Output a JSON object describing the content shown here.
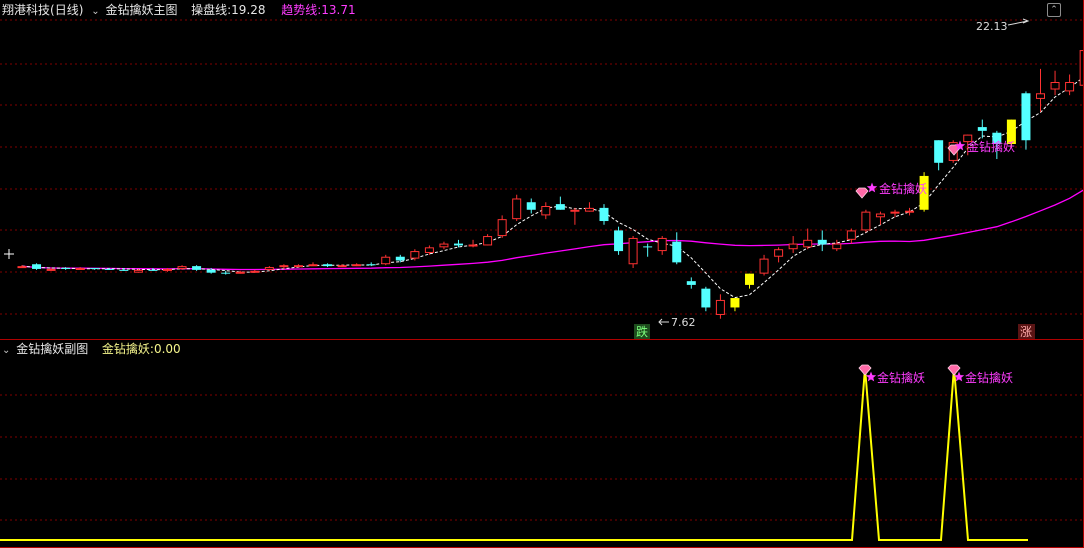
{
  "main_panel": {
    "title": "金钻擒妖主图",
    "stock": "翔港科技",
    "period": "(日线)",
    "ind1_label": "操盘线",
    "ind1_value": "19.28",
    "ind2_label": "趋势线",
    "ind2_value": "13.71",
    "high_label": "22.13",
    "low_label": "7.62",
    "signal_label": "金钻擒妖",
    "marker_down": "跌",
    "marker_up": "涨"
  },
  "sub_panel": {
    "title": "金钻擒妖副图",
    "ind_label": "金钻擒妖",
    "ind_value": "0.00",
    "signal_label": "金钻擒妖"
  },
  "colors": {
    "up": "#ff3232",
    "down": "#54ffff",
    "signal": "#ffff00",
    "trend": "#ff00ff",
    "grid": "#800000",
    "border": "#b00000",
    "sub_line": "#ffff00"
  },
  "chart_data": {
    "type": "candlestick",
    "y_range": [
      7.0,
      23.5
    ],
    "candles": [
      [
        10.4,
        10.45,
        10.35,
        10.4,
        "u"
      ],
      [
        10.5,
        10.55,
        10.2,
        10.25,
        "d"
      ],
      [
        10.25,
        10.3,
        10.2,
        10.25,
        "u"
      ],
      [
        10.3,
        10.35,
        10.2,
        10.25,
        "d"
      ],
      [
        10.2,
        10.35,
        10.2,
        10.3,
        "u"
      ],
      [
        10.3,
        10.3,
        10.2,
        10.25,
        "d"
      ],
      [
        10.25,
        10.3,
        10.2,
        10.25,
        "d"
      ],
      [
        10.2,
        10.3,
        10.15,
        10.2,
        "d"
      ],
      [
        10.05,
        10.25,
        10.05,
        10.2,
        "u"
      ],
      [
        10.2,
        10.3,
        10.15,
        10.2,
        "d"
      ],
      [
        10.2,
        10.3,
        10.1,
        10.25,
        "u"
      ],
      [
        10.25,
        10.45,
        10.2,
        10.4,
        "u"
      ],
      [
        10.4,
        10.45,
        10.15,
        10.2,
        "d"
      ],
      [
        10.2,
        10.3,
        10.0,
        10.05,
        "d"
      ],
      [
        10.05,
        10.15,
        9.95,
        10.0,
        "d"
      ],
      [
        10.05,
        10.15,
        10.0,
        10.1,
        "u"
      ],
      [
        10.1,
        10.2,
        10.05,
        10.15,
        "u"
      ],
      [
        10.2,
        10.4,
        10.15,
        10.35,
        "u"
      ],
      [
        10.35,
        10.5,
        10.25,
        10.45,
        "u"
      ],
      [
        10.45,
        10.5,
        10.35,
        10.45,
        "u"
      ],
      [
        10.45,
        10.6,
        10.4,
        10.5,
        "u"
      ],
      [
        10.5,
        10.55,
        10.35,
        10.4,
        "d"
      ],
      [
        10.4,
        10.5,
        10.35,
        10.45,
        "u"
      ],
      [
        10.45,
        10.55,
        10.4,
        10.5,
        "u"
      ],
      [
        10.5,
        10.6,
        10.4,
        10.45,
        "d"
      ],
      [
        10.5,
        11.0,
        10.45,
        10.9,
        "u"
      ],
      [
        10.9,
        11.0,
        10.6,
        10.7,
        "d"
      ],
      [
        10.8,
        11.3,
        10.7,
        11.2,
        "u"
      ],
      [
        11.1,
        11.5,
        11.0,
        11.4,
        "u"
      ],
      [
        11.4,
        11.7,
        11.3,
        11.6,
        "u"
      ],
      [
        11.6,
        11.8,
        11.4,
        11.5,
        "d"
      ],
      [
        11.5,
        11.8,
        11.4,
        11.55,
        "u"
      ],
      [
        11.5,
        12.1,
        11.5,
        12.0,
        "u"
      ],
      [
        12.0,
        13.1,
        11.9,
        12.9,
        "u"
      ],
      [
        12.9,
        14.2,
        12.8,
        14.0,
        "u"
      ],
      [
        13.8,
        14.0,
        13.2,
        13.4,
        "d"
      ],
      [
        13.1,
        13.8,
        12.9,
        13.6,
        "u"
      ],
      [
        13.7,
        14.1,
        13.4,
        13.4,
        "d"
      ],
      [
        13.4,
        13.5,
        12.6,
        13.4,
        "u"
      ],
      [
        13.3,
        13.8,
        13.3,
        13.5,
        "u"
      ],
      [
        13.5,
        13.7,
        12.6,
        12.8,
        "d"
      ],
      [
        12.3,
        12.5,
        11.0,
        11.2,
        "d"
      ],
      [
        10.5,
        12.0,
        10.3,
        11.9,
        "u"
      ],
      [
        11.4,
        11.6,
        10.9,
        11.45,
        "d"
      ],
      [
        11.2,
        12.0,
        11.0,
        11.9,
        "u"
      ],
      [
        11.7,
        12.2,
        10.5,
        10.6,
        "d"
      ],
      [
        9.6,
        9.8,
        9.2,
        9.4,
        "d"
      ],
      [
        9.2,
        9.3,
        8.0,
        8.2,
        "d"
      ],
      [
        7.8,
        8.9,
        7.6,
        8.6,
        "u"
      ],
      [
        8.2,
        8.7,
        8.0,
        8.7,
        "s"
      ],
      [
        9.4,
        10.0,
        9.2,
        10.0,
        "s"
      ],
      [
        10.0,
        11.0,
        9.9,
        10.8,
        "u"
      ],
      [
        10.9,
        11.4,
        10.6,
        11.3,
        "u"
      ],
      [
        11.3,
        12.0,
        11.1,
        11.6,
        "u"
      ],
      [
        11.4,
        12.4,
        11.3,
        11.8,
        "u"
      ],
      [
        11.8,
        12.3,
        11.2,
        11.55,
        "d"
      ],
      [
        11.3,
        11.8,
        11.2,
        11.6,
        "u"
      ],
      [
        11.8,
        12.4,
        11.6,
        12.3,
        "u"
      ],
      [
        12.3,
        13.4,
        12.2,
        13.3,
        "u"
      ],
      [
        13.0,
        13.3,
        12.6,
        13.2,
        "u"
      ],
      [
        13.2,
        13.4,
        13.0,
        13.3,
        "u"
      ],
      [
        13.3,
        13.5,
        13.1,
        13.35,
        "u"
      ],
      [
        13.4,
        15.4,
        13.3,
        15.2,
        "s"
      ],
      [
        15.9,
        17.1,
        15.5,
        17.1,
        "d"
      ],
      [
        16.0,
        17.1,
        15.9,
        17.0,
        "u"
      ],
      [
        17.0,
        17.4,
        16.3,
        17.4,
        "u"
      ],
      [
        17.6,
        18.2,
        17.2,
        17.8,
        "d"
      ],
      [
        17.5,
        17.6,
        16.1,
        16.9,
        "d"
      ],
      [
        16.9,
        18.2,
        16.7,
        18.2,
        "s"
      ],
      [
        17.1,
        19.7,
        16.6,
        19.6,
        "d"
      ],
      [
        19.3,
        20.9,
        18.6,
        19.6,
        "u"
      ],
      [
        19.8,
        20.8,
        19.5,
        20.2,
        "u"
      ],
      [
        19.7,
        20.6,
        19.5,
        20.2,
        "u"
      ],
      [
        20.0,
        22.1,
        19.6,
        21.9,
        "u"
      ]
    ],
    "signal_days": [
      62,
      69
    ],
    "low_point": 7.62,
    "high_point": 22.13,
    "sub_signal_value": 1
  }
}
